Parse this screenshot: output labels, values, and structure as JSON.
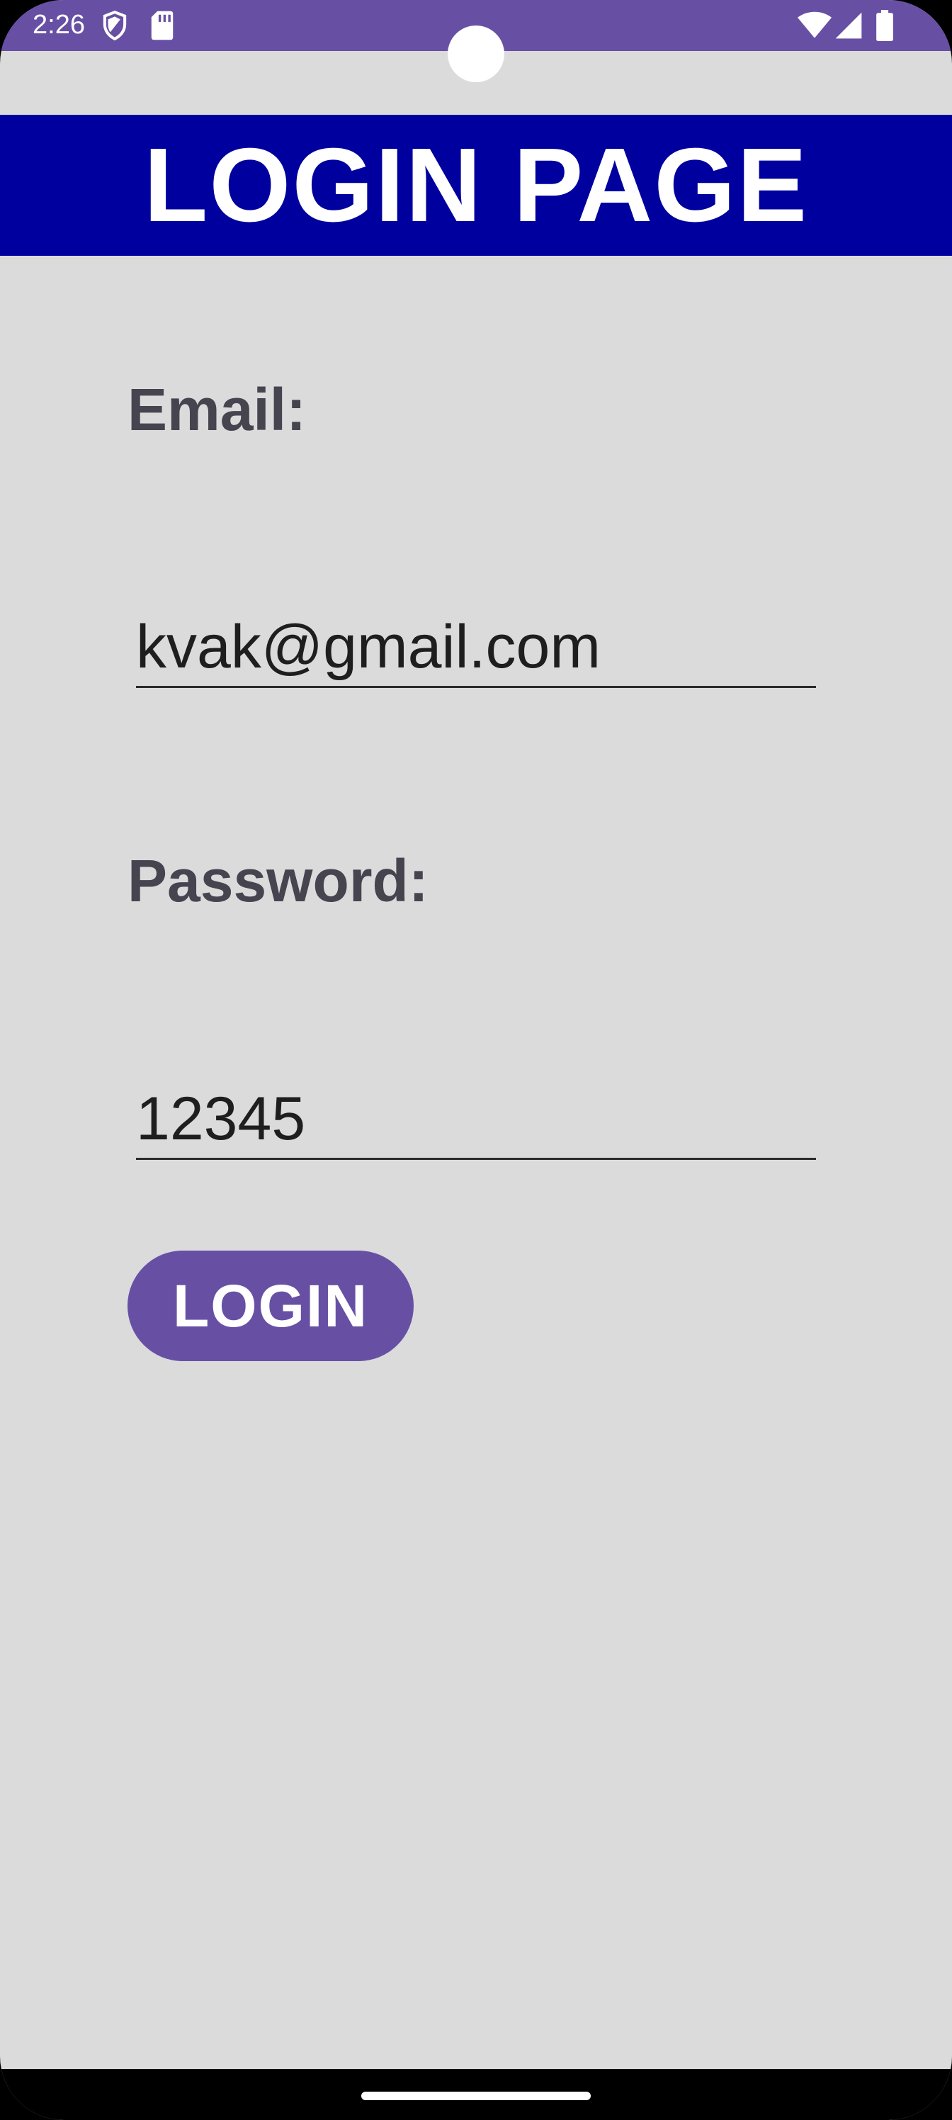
{
  "status_bar": {
    "time": "2:26",
    "color": "#6750A4",
    "icons_left": [
      "shield-icon",
      "sd-card-icon"
    ],
    "icons_right": [
      "wifi-icon",
      "cell-signal-icon",
      "battery-icon"
    ]
  },
  "header": {
    "title": "LOGIN PAGE",
    "background": "#00009E"
  },
  "form": {
    "email_label": "Email:",
    "email_value": "kvak@gmail.com",
    "password_label": "Password:",
    "password_value": "12345",
    "login_button": "LOGIN",
    "accent": "#6750A4"
  }
}
